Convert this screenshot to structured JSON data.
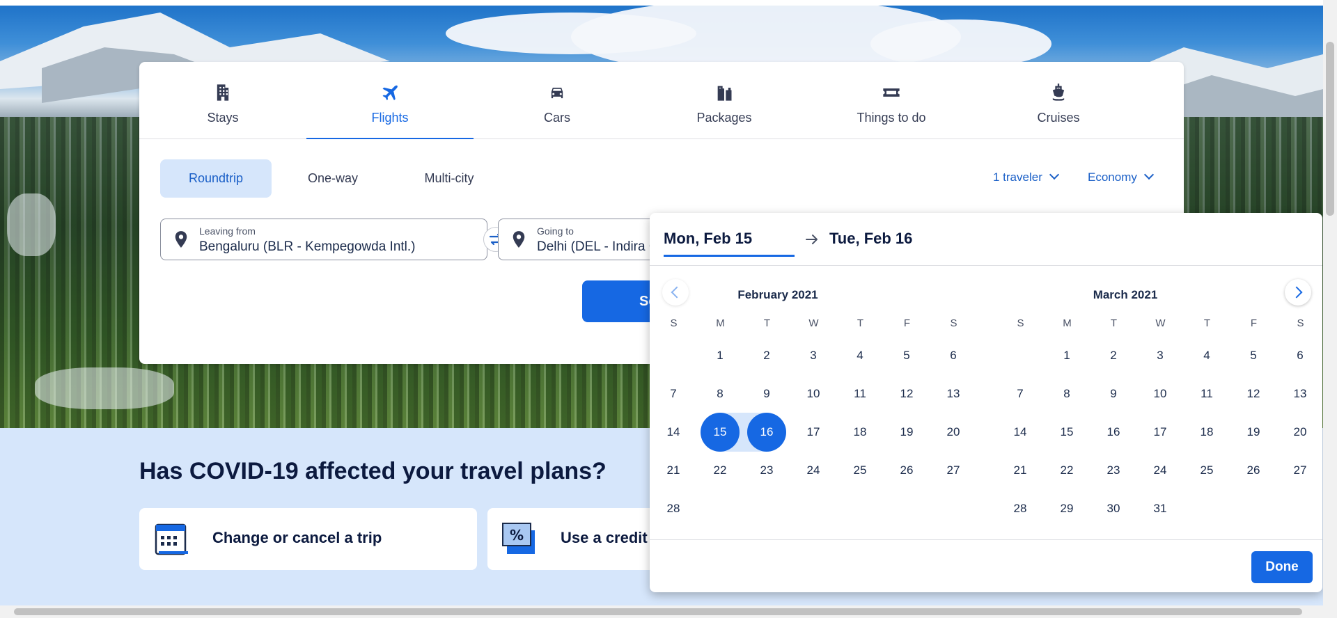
{
  "colors": {
    "accent": "#1668e3",
    "accent_light": "#d6e6fb",
    "text_dark": "#0c1a3f"
  },
  "tabs": [
    {
      "label": "Stays",
      "icon": "building-icon"
    },
    {
      "label": "Flights",
      "icon": "plane-icon",
      "active": true
    },
    {
      "label": "Cars",
      "icon": "car-icon"
    },
    {
      "label": "Packages",
      "icon": "luggage-icon"
    },
    {
      "label": "Things to do",
      "icon": "ticket-icon"
    },
    {
      "label": "Cruises",
      "icon": "ship-icon"
    }
  ],
  "trip_types": {
    "roundtrip": "Roundtrip",
    "oneway": "One-way",
    "multicity": "Multi-city",
    "selected": "Roundtrip"
  },
  "travelers": "1 traveler",
  "cabin_class": "Economy",
  "leaving_from": {
    "label": "Leaving from",
    "value": "Bengaluru (BLR - Kempegowda Intl.)"
  },
  "going_to": {
    "label": "Going to",
    "value": "Delhi (DEL - Indira Gandhi Intl.)"
  },
  "search_button": "Search",
  "covid": {
    "title": "Has COVID-19 affected your travel plans?",
    "card1": "Change or cancel a trip",
    "card2": "Use a credit"
  },
  "date_picker": {
    "start_label": "Mon, Feb 15",
    "end_label": "Tue, Feb 16",
    "weekday_letters": [
      "S",
      "M",
      "T",
      "W",
      "T",
      "F",
      "S"
    ],
    "months": [
      {
        "title": "February 2021",
        "first_weekday": 1,
        "days": 28
      },
      {
        "title": "March 2021",
        "first_weekday": 1,
        "days": 31
      }
    ],
    "selected_start": 15,
    "selected_end": 16,
    "done_label": "Done"
  }
}
